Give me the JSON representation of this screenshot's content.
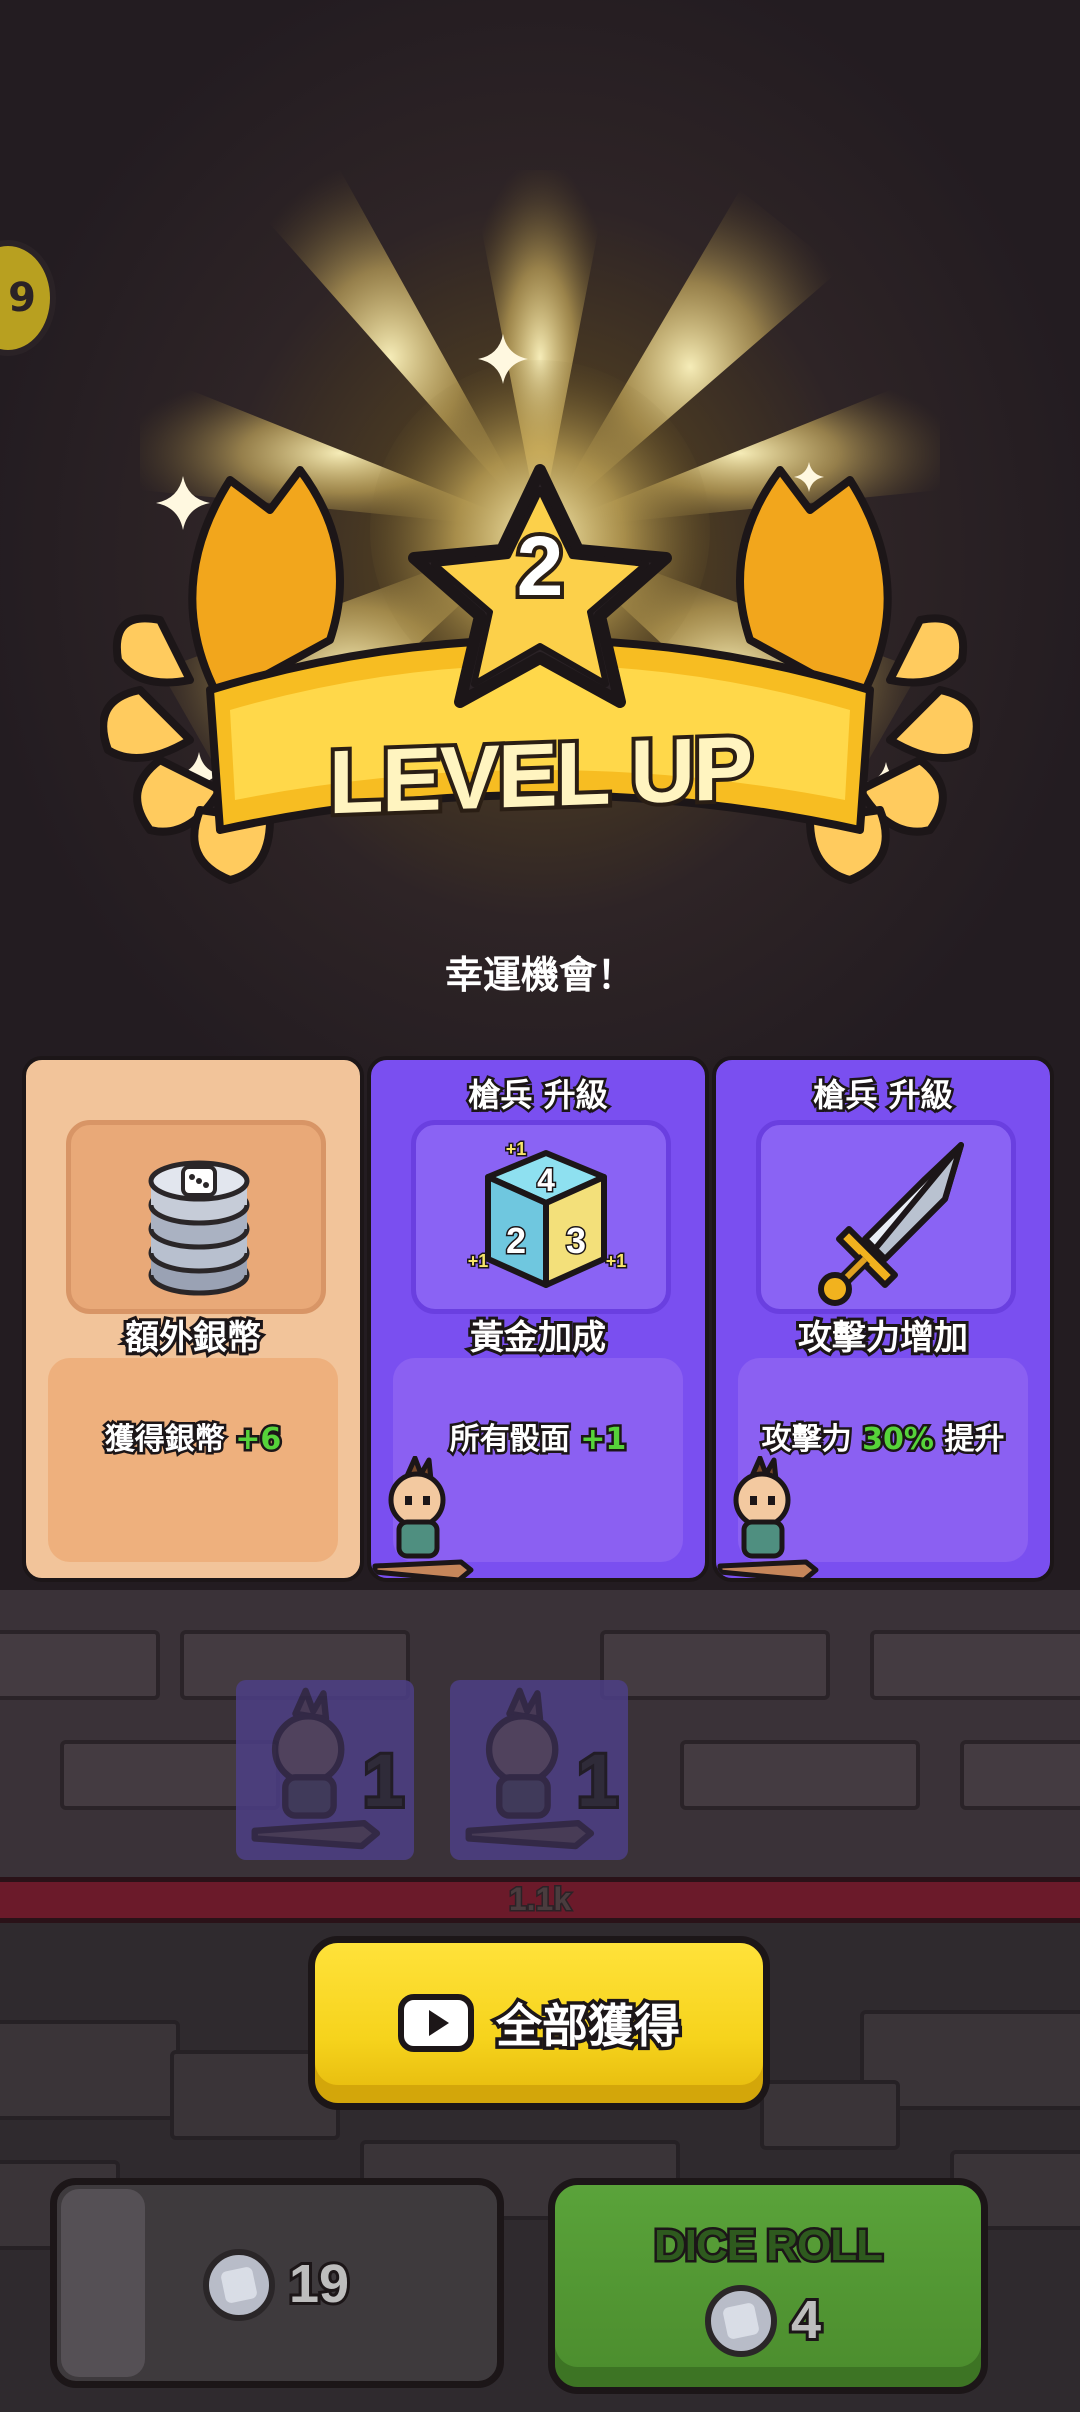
{
  "side_badge": {
    "glyph": "9"
  },
  "level_up": {
    "level": "2",
    "title": "LEVEL UP"
  },
  "subtitle": "幸運機會！",
  "cards": [
    {
      "header": "",
      "name": "額外銀幣",
      "desc_prefix": "獲得銀幣 ",
      "desc_value": "+6",
      "desc_suffix": "",
      "theme": "orange",
      "icon": "silver-coin-stack-icon"
    },
    {
      "header": "槍兵 升級",
      "name": "黃金加成",
      "desc_prefix": "所有骰面 ",
      "desc_value": "+1",
      "desc_suffix": "",
      "theme": "purple",
      "icon": "dice-icon",
      "dice_faces": [
        "4",
        "2",
        "3"
      ],
      "dice_bonus": "+1"
    },
    {
      "header": "槍兵 升級",
      "name": "攻擊力增加",
      "desc_prefix": "攻擊力 ",
      "desc_value": "30%",
      "desc_suffix": " 提升",
      "theme": "purple",
      "icon": "sword-icon"
    }
  ],
  "unit_slots": [
    {
      "count": "1",
      "unit": "spearman"
    },
    {
      "count": "1",
      "unit": "spearman"
    }
  ],
  "enemy_hp": {
    "text": "1.1k"
  },
  "collect_all": {
    "label": "全部獲得",
    "icon": "video-play-icon"
  },
  "coins": {
    "count": "19"
  },
  "dice_roll": {
    "label": "DICE ROLL",
    "cost": "4"
  },
  "colors": {
    "orange_card": "#f2c49a",
    "purple_card": "#7a4ff0",
    "highlight": "#56d33a",
    "collect_button": "#f6d31c",
    "dice_roll_button": "#4b8c2d",
    "hp_bar": "#6b1a2a"
  }
}
